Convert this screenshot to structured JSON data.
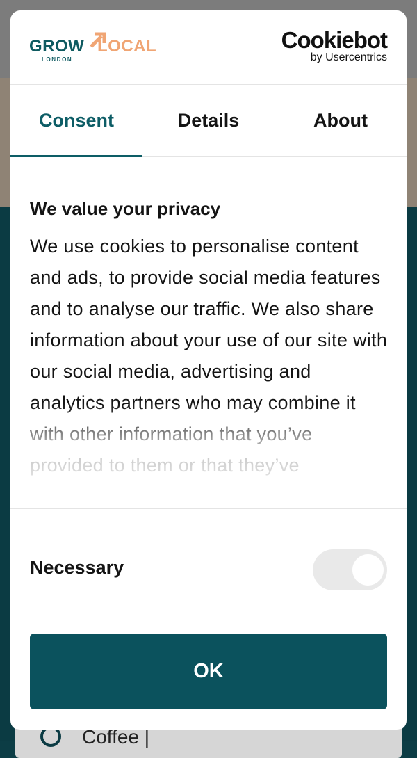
{
  "colors": {
    "accent": "#0b525d",
    "active_tab": "#0d5d66",
    "brand_grow": "#0e5a60",
    "brand_local": "#f0a574",
    "toggle_bg": "#e9e9e9"
  },
  "header": {
    "brand": {
      "grow": "GROW",
      "local": "LOCAL",
      "city": "LONDON"
    },
    "cookiebot": {
      "name": "Cookiebot",
      "by": "by Usercentrics"
    }
  },
  "tabs": [
    {
      "label": "Consent",
      "active": true
    },
    {
      "label": "Details",
      "active": false
    },
    {
      "label": "About",
      "active": false
    }
  ],
  "content": {
    "title": "We value your privacy",
    "body": "We use cookies to personalise content and ads, to provide social media features and to analyse our traffic. We also share information about your use of our site with our social media, advertising and analytics partners who may combine it with other information that you’ve provided to them or that they’ve"
  },
  "preferences": {
    "necessary": {
      "label": "Necessary",
      "enabled": true,
      "locked": true
    }
  },
  "actions": {
    "ok_label": "OK"
  },
  "background": {
    "option_label": "Coffee |"
  }
}
